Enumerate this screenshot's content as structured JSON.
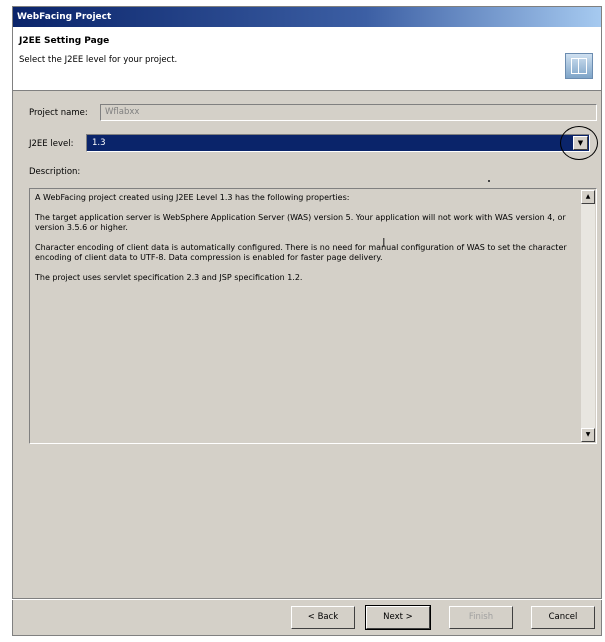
{
  "window": {
    "title": "WebFacing Project"
  },
  "header": {
    "page_title": "J2EE Setting Page",
    "page_description": "Select the J2EE level for your project."
  },
  "form": {
    "project_name_label": "Project name:",
    "project_name_value": "Wflabxx",
    "j2ee_level_label": "J2EE level:",
    "j2ee_level_value": "1.3",
    "description_label": "Description:"
  },
  "description_paragraphs": [
    "A WebFacing project created using J2EE Level 1.3 has the following properties:",
    "The target application server is WebSphere Application Server (WAS) version 5.  Your application will not work with WAS version 4, or version 3.5.6 or higher.",
    "Character encoding of client data is automatically configured.  There is no need for manual configuration of WAS to set the character encoding of client data to UTF-8.  Data compression is enabled for faster page delivery.",
    "The project uses servlet specification 2.3 and JSP specification 1.2."
  ],
  "buttons": {
    "back": "< Back",
    "next": "Next >",
    "finish": "Finish",
    "cancel": "Cancel"
  },
  "icons": {
    "banner": "wizard-banner-icon",
    "dropdown": "chevron-down-icon"
  }
}
